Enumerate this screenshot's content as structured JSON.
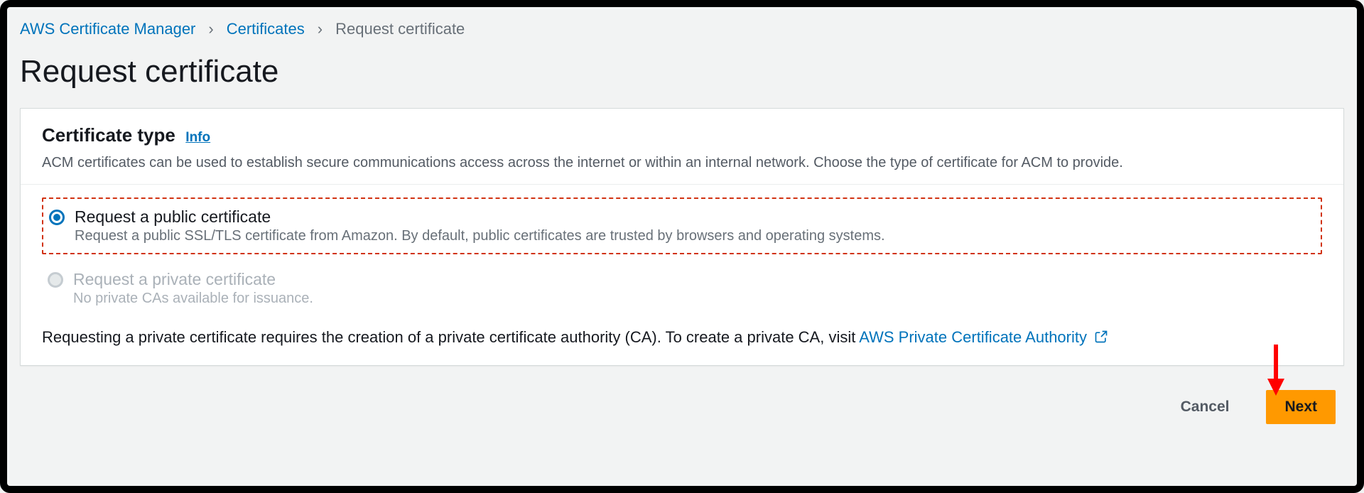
{
  "breadcrumb": {
    "root": "AWS Certificate Manager",
    "mid": "Certificates",
    "current": "Request certificate"
  },
  "page": {
    "title": "Request certificate"
  },
  "card": {
    "heading": "Certificate type",
    "info_label": "Info",
    "description": "ACM certificates can be used to establish secure communications access across the internet or within an internal network. Choose the type of certificate for ACM to provide."
  },
  "options": {
    "public": {
      "title": "Request a public certificate",
      "desc": "Request a public SSL/TLS certificate from Amazon. By default, public certificates are trusted by browsers and operating systems."
    },
    "private": {
      "title": "Request a private certificate",
      "desc": "No private CAs available for issuance."
    }
  },
  "footnote": {
    "text": "Requesting a private certificate requires the creation of a private certificate authority (CA). To create a private CA, visit ",
    "link_text": "AWS Private Certificate Authority"
  },
  "buttons": {
    "cancel": "Cancel",
    "next": "Next"
  }
}
